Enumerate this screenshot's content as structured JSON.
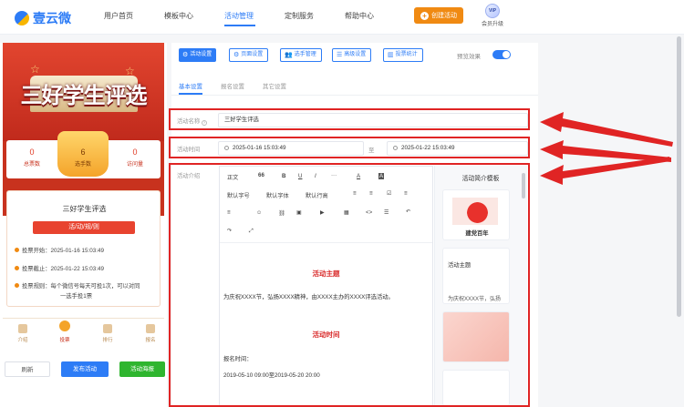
{
  "header": {
    "brand": "壹云微",
    "nav": [
      "用户首页",
      "模板中心",
      "活动管理",
      "定制服务",
      "帮助中心"
    ],
    "active_nav": "活动管理",
    "create_button": "创建活动",
    "vip_badge": "VIP",
    "vip_label": "会员升级",
    "accent": "#2d7cf6"
  },
  "preview": {
    "hero_title": "三好学生评选",
    "stats": [
      {
        "value": "0",
        "label": "总票数"
      },
      {
        "value": "6",
        "label": "选手数"
      },
      {
        "value": "0",
        "label": "访问量"
      }
    ],
    "rules_title": "三好学生评选",
    "rules_ribbon": "活/动/规/则",
    "rules": [
      "投票开始：2025-01-16 15:03:49",
      "投票截止：2025-01-22 15:03:49",
      "投票规则：每个微信号每天可投1次，可以对同",
      "一选手投1票"
    ],
    "tabs": [
      "介绍",
      "投票",
      "排行",
      "报名"
    ],
    "actions": [
      "刷新",
      "发布活动",
      "活动海报"
    ]
  },
  "editor": {
    "toolbar": [
      "活动设置",
      "页面设置",
      "选手管理",
      "高级设置",
      "投票统计"
    ],
    "preview_toggle": "预览效果",
    "subtabs": [
      "基本设置",
      "报名设置",
      "其它设置"
    ],
    "fields": {
      "name_label": "活动名称",
      "name_value": "三好学生评选",
      "time_label": "活动时间",
      "start_time": "2025-01-16 15:03:49",
      "to": "至",
      "end_time": "2025-01-22 15:03:49",
      "intro_label": "活动介绍"
    },
    "rte_toolbar": {
      "row1": [
        "正文",
        "66",
        "B",
        "U",
        "I",
        "···",
        "A",
        "A"
      ],
      "row2": [
        "默认字号",
        "默认字体",
        "默认行高",
        "≡",
        "≡",
        "☑",
        "≡"
      ],
      "row3": [
        "≡",
        "☺",
        "⛓",
        "▣",
        "▶",
        "▦",
        "<>",
        "☰",
        "↶"
      ],
      "row4": [
        "↷",
        "⤢"
      ]
    },
    "rte_content": {
      "heading1": "活动主题",
      "para1": "为庆祝XXXX节，弘扬XXXX精神，由XXXX主办的XXXX评选活动。",
      "heading2": "活动时间",
      "para2": "报名时间：",
      "para3": "2019-05-10 09:00至2019-05-20 20:00"
    },
    "templates": {
      "title": "活动简介模板",
      "cards": [
        "建党百年",
        "活动主题",
        "为庆祝XXXX节，弘扬"
      ]
    }
  }
}
